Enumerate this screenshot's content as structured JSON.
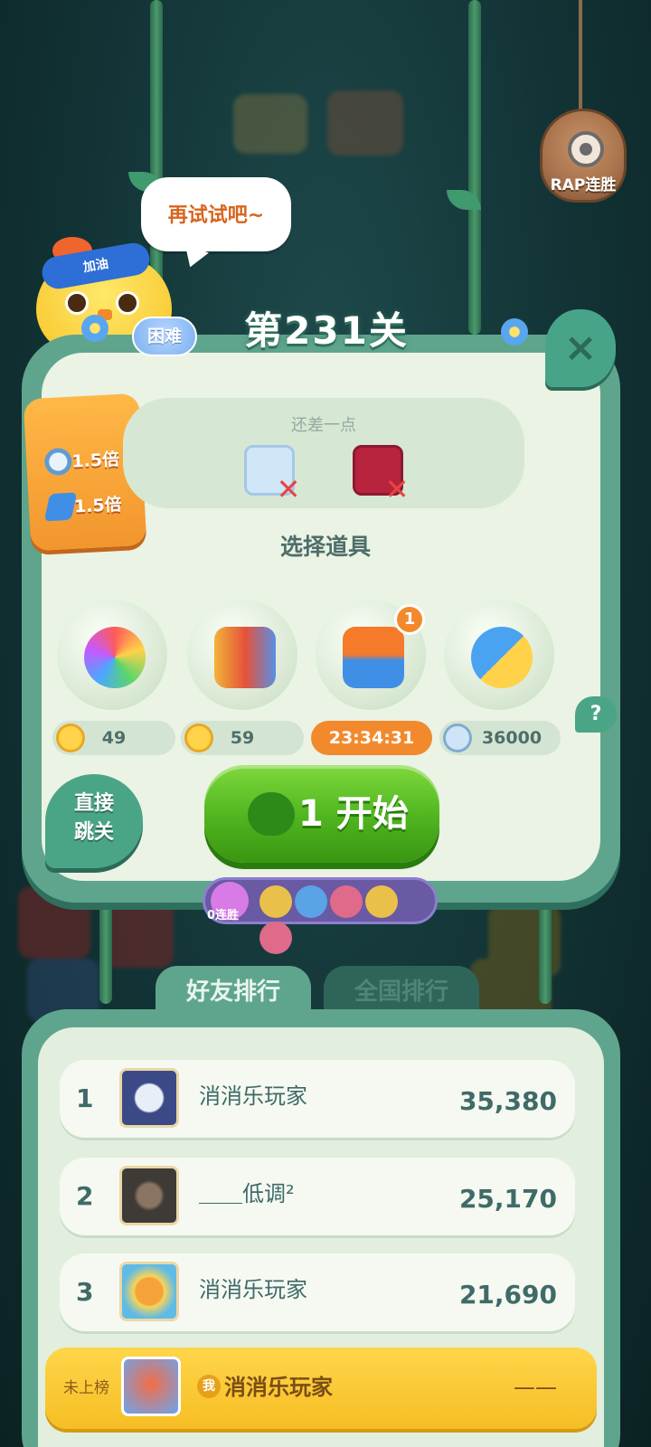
{
  "speech_bubble": "再试试吧~",
  "chick_headband": "加油",
  "rap_badge": "RAP连胜",
  "level": {
    "difficulty": "困难",
    "title": "第231关",
    "close_icon": "×"
  },
  "bonus": {
    "items": [
      {
        "icon": "coin-ring-icon",
        "text": "1.5倍"
      },
      {
        "icon": "lightning-icon",
        "text": "1.5倍"
      }
    ]
  },
  "missing": {
    "title": "还差一点",
    "items": [
      {
        "icon": "ice-block-icon",
        "color": "#cfe6f7"
      },
      {
        "icon": "jelly-block-icon",
        "color": "#b8233e"
      }
    ]
  },
  "props": {
    "title": "选择道具",
    "items": [
      {
        "icon": "rainbow-owl-icon",
        "count": "49",
        "currency": "coin"
      },
      {
        "icon": "rocket-bundle-icon",
        "count": "59",
        "currency": "coin"
      },
      {
        "icon": "plus3-moves-icon",
        "count": "23:34:31",
        "badge": "1",
        "currency": "timer"
      },
      {
        "icon": "swap-pets-icon",
        "count": "36000",
        "currency": "silver"
      }
    ],
    "help_label": "?"
  },
  "skip": {
    "line1": "直接",
    "line2": "跳关"
  },
  "start": {
    "label": "1 开始"
  },
  "streak": {
    "label": "0连胜"
  },
  "ranking": {
    "tabs": [
      "好友排行",
      "全国排行"
    ],
    "rows": [
      {
        "rank": "1",
        "name": "消消乐玩家",
        "score": "35,380",
        "avatar_color": "#3b4a86"
      },
      {
        "rank": "2",
        "name": "＿＿低调²",
        "score": "25,170",
        "avatar_color": "#5b5148"
      },
      {
        "rank": "3",
        "name": "消消乐玩家",
        "score": "21,690",
        "avatar_color": "#f6a23a"
      }
    ],
    "me": {
      "status": "未上榜",
      "badge": "我",
      "name": "消消乐玩家",
      "score": "——"
    }
  }
}
